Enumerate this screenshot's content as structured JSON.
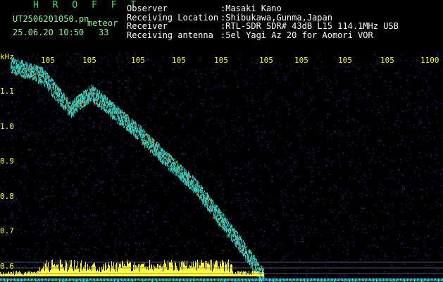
{
  "app": {
    "title": "H R O F F T",
    "filename": "UT2506201050.pn",
    "timestamp": "25.06.20 10:50",
    "event_label": "meteor",
    "event_count": "33"
  },
  "info": [
    {
      "key": "Observer",
      "value": ":Masaki Kano"
    },
    {
      "key": "Receiving Location",
      "value": ":Shibukawa,Gunma,Japan"
    },
    {
      "key": "Receiver",
      "value": ":RTL-SDR SDR# 43dB L15 114.1MHz USB"
    },
    {
      "key": "Receiving antenna",
      "value": ":5el Yagi Az 20 for Aomori VOR"
    }
  ],
  "axes": {
    "y_unit": "kHz",
    "y_ticks": [
      "1.1",
      "1.0",
      "0.9",
      "0.8",
      "0.7",
      "0.6"
    ],
    "x_ticks": [
      "105",
      "105",
      "105",
      "105",
      "105",
      "105",
      "105",
      "105",
      "105",
      "1100"
    ],
    "x_tick_color": "#ffff00",
    "y_tick_color": "#ffff00"
  },
  "colors": {
    "background": "#000000",
    "grid": "#6a6a9a",
    "noise": "#1e2a8c",
    "signal": "#35c8c8",
    "signal_hot": "#ff8a3a",
    "meteor_band": "#ffff33"
  }
}
